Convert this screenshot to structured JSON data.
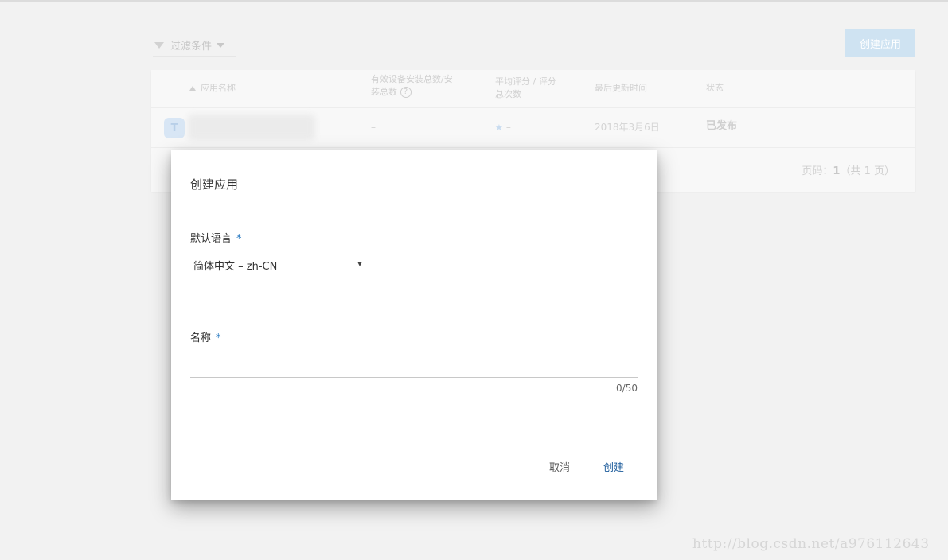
{
  "toolbar": {
    "filter_label": "过滤条件",
    "create_button": "创建应用"
  },
  "table": {
    "headers": {
      "name": "应用名称",
      "installs_line1": "有效设备安装总数/安",
      "installs_line2": "装总数",
      "rating_line1": "平均评分 / 评分",
      "rating_line2": "总次数",
      "updated": "最后更新时间",
      "status": "状态"
    },
    "row": {
      "icon_letter": "T",
      "installs": "–",
      "rating": "–",
      "updated": "2018年3月6日",
      "status": "已发布"
    },
    "pager": {
      "prefix": "页码：",
      "page": "1",
      "total_text": "（共 1 页）"
    }
  },
  "dialog": {
    "title": "创建应用",
    "language_label": "默认语言",
    "language_value": "简体中文 – zh-CN",
    "name_label": "名称",
    "required_mark": "*",
    "name_value": "",
    "counter": "0/50",
    "cancel": "取消",
    "create": "创建"
  },
  "watermark": "http://blog.csdn.net/a976112643"
}
